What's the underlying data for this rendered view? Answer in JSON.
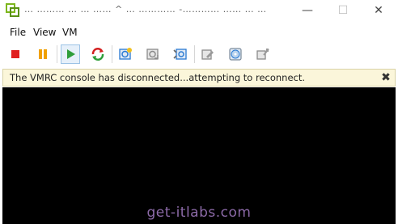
{
  "window": {
    "title": "… ……… … … …… ^ … ………… -………… …… … …",
    "minimize_glyph": "—",
    "maximize_glyph": "☐",
    "close_glyph": "✕"
  },
  "menu": {
    "file": "File",
    "view": "View",
    "vm": "VM"
  },
  "toolbar": {
    "icons": [
      "stop-icon",
      "pause-icon",
      "play-icon",
      "refresh-icon",
      "snapshot-icon",
      "revert-snapshot-icon",
      "manage-snapshots-icon",
      "vm-settings-icon",
      "cd-dvd-icon",
      "usb-device-icon"
    ],
    "colors": {
      "stop": "#e02020",
      "pause": "#f0a000",
      "play": "#2e9e3a",
      "refresh_red": "#d32020",
      "refresh_green": "#2e9e3a",
      "snapshot_blue": "#2a7ad2",
      "disabled": "#8a8a8a"
    }
  },
  "notification": {
    "message": "The VMRC console has disconnected...attempting to reconnect.",
    "close_glyph": "✖"
  },
  "console": {
    "watermark": "get-itlabs.com"
  }
}
